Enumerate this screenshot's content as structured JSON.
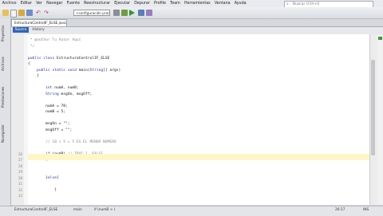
{
  "menu": [
    "Archivo",
    "Editar",
    "Ver",
    "Navegar",
    "Fuente",
    "Reestructurar",
    "Ejecutar",
    "Depurar",
    "Profile",
    "Team",
    "Herramientas",
    "Ventana",
    "Ayuda"
  ],
  "search": {
    "placeholder": "Buscar (Ctrl+I)"
  },
  "toolbar": {
    "config_value": "<configuración predet..."
  },
  "sidebar": {
    "tabs": [
      "Proyectos",
      "Archivos",
      "Prestaciones",
      "Navegador"
    ]
  },
  "editor": {
    "file_tab": "EstructuraControlIF_ELSE.java",
    "source_label": "Source",
    "history_label": "History",
    "lines": [
      {
        "n": "",
        "t": " * @author Tu Autor Aquí"
      },
      {
        "n": "",
        "t": " */"
      },
      {
        "n": "",
        "t": ""
      },
      {
        "n": "",
        "t": "public class EstructuraControlIF_ELSE"
      },
      {
        "n": "",
        "t": "{"
      },
      {
        "n": "",
        "t": "    public static void main(String[] args)"
      },
      {
        "n": "",
        "t": "    {"
      },
      {
        "n": "",
        "t": ""
      },
      {
        "n": "",
        "t": "        int numA, numB;"
      },
      {
        "n": "",
        "t": "        String msgOn, msgOff;"
      },
      {
        "n": "",
        "t": ""
      },
      {
        "n": "",
        "t": "        numA = 78;"
      },
      {
        "n": "",
        "t": "        numB = 5;"
      },
      {
        "n": "",
        "t": ""
      },
      {
        "n": "",
        "t": "        msgOn = \"\";"
      },
      {
        "n": "",
        "t": "        msgOff = \"\";"
      },
      {
        "n": "",
        "t": ""
      },
      {
        "n": "",
        "t": "        // 10 < 5 = 5 ES EL MENOR NUMERO"
      },
      {
        "n": "",
        "t": ""
      },
      {
        "n": "26",
        "t": "        if (numB) // TRUE 1, FALSE"
      },
      {
        "n": "27",
        "t": "        {"
      },
      {
        "n": "28",
        "t": ""
      },
      {
        "n": "29",
        "t": ""
      },
      {
        "n": "30",
        "t": "        }else{"
      },
      {
        "n": "31",
        "t": ""
      },
      {
        "n": "32",
        "t": "            }"
      },
      {
        "n": "33",
        "t": ""
      }
    ]
  },
  "status": {
    "nav_item1": "EstructuraControlIF_ELSE",
    "nav_item2": "main",
    "nav_item3": "if (numB > )",
    "position": "26:17",
    "mode": "INS"
  }
}
